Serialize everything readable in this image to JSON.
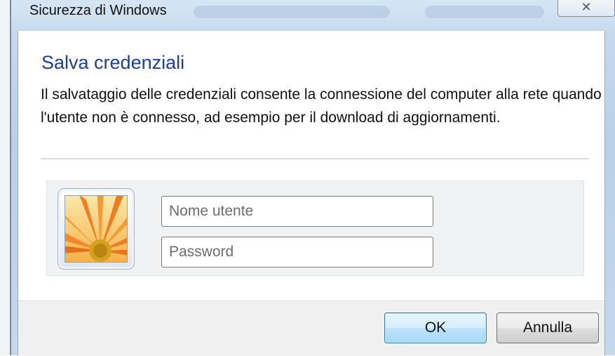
{
  "window": {
    "title": "Sicurezza di Windows",
    "close_glyph": "✕"
  },
  "dialog": {
    "heading": "Salva credenziali",
    "description": "Il salvataggio delle credenziali consente la connessione del computer alla rete quando l'utente non è connesso, ad esempio per il download di aggiornamenti."
  },
  "credentials": {
    "user_tile_icon": "user-tile-flower-icon",
    "username": {
      "value": "",
      "placeholder": "Nome utente"
    },
    "password": {
      "value": "",
      "placeholder": "Password"
    }
  },
  "buttons": {
    "ok_label": "OK",
    "cancel_label": "Annulla"
  },
  "colors": {
    "heading": "#1d3f9b",
    "ok_button_border": "#3c7fb1"
  }
}
